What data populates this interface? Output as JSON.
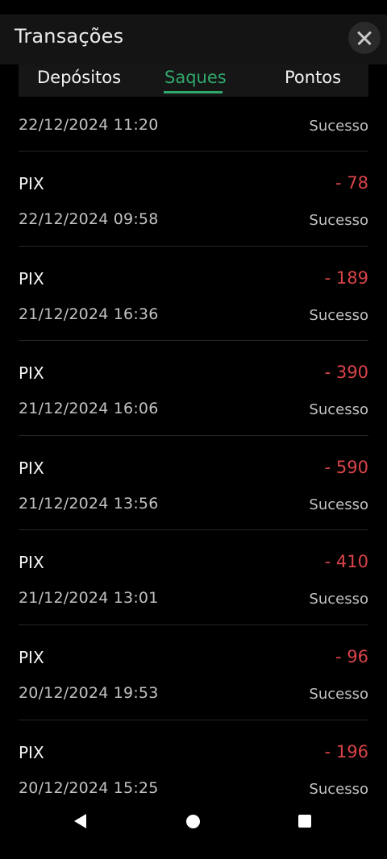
{
  "header": {
    "title": "Transações"
  },
  "tabs": [
    {
      "label": "Depósitos",
      "active": false
    },
    {
      "label": "Saques",
      "active": true
    },
    {
      "label": "Pontos",
      "active": false
    }
  ],
  "colors": {
    "accent": "#2fa86a",
    "negative": "#d9444a",
    "background": "#000000"
  },
  "partial_item": {
    "date": "22/12/2024 11:20",
    "status": "Sucesso"
  },
  "transactions": [
    {
      "method": "PIX",
      "amount": "- 78",
      "date": "22/12/2024 09:58",
      "status": "Sucesso"
    },
    {
      "method": "PIX",
      "amount": "- 189",
      "date": "21/12/2024 16:36",
      "status": "Sucesso"
    },
    {
      "method": "PIX",
      "amount": "- 390",
      "date": "21/12/2024 16:06",
      "status": "Sucesso"
    },
    {
      "method": "PIX",
      "amount": "- 590",
      "date": "21/12/2024 13:56",
      "status": "Sucesso"
    },
    {
      "method": "PIX",
      "amount": "- 410",
      "date": "21/12/2024 13:01",
      "status": "Sucesso"
    },
    {
      "method": "PIX",
      "amount": "- 96",
      "date": "20/12/2024 19:53",
      "status": "Sucesso"
    },
    {
      "method": "PIX",
      "amount": "- 196",
      "date": "20/12/2024 15:25",
      "status": "Sucesso"
    }
  ],
  "nav": {
    "back_icon": "back-triangle-icon",
    "home_icon": "home-circle-icon",
    "recent_icon": "recent-square-icon"
  }
}
